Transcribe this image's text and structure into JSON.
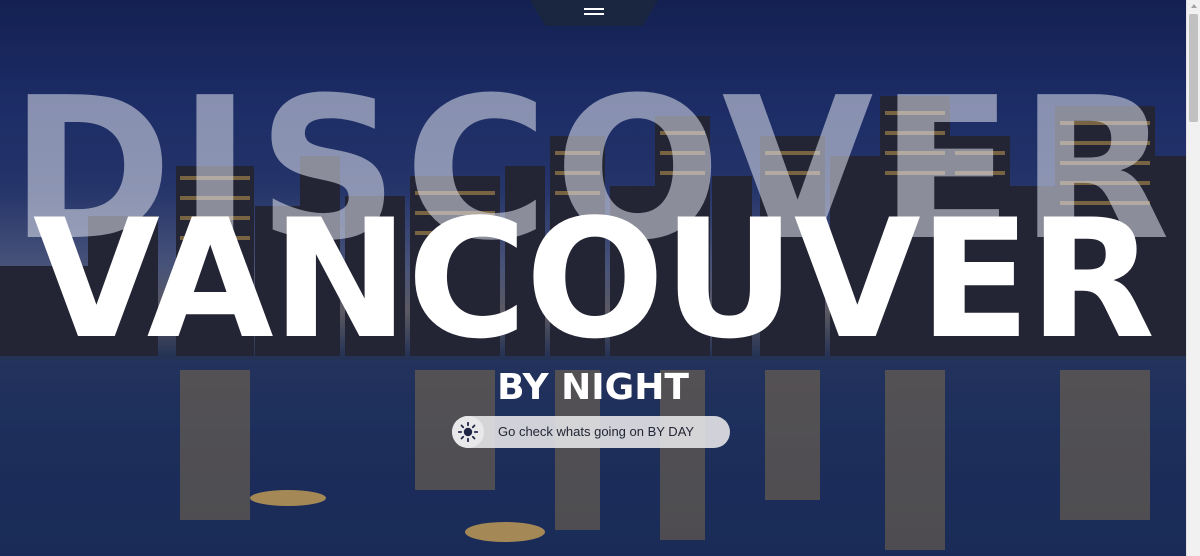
{
  "hero": {
    "headline_top": "DISCOVER",
    "headline_main": "VANCOUVER",
    "subheadline": "BY NIGHT"
  },
  "nav": {
    "menu_icon": "hamburger-menu-icon"
  },
  "day_button": {
    "icon": "sun-icon",
    "label": "Go check whats going on BY DAY"
  },
  "colors": {
    "nav_tab": "#1a2540",
    "button_bg": "#e1e1e4",
    "button_text": "#222533",
    "headline": "#ffffff"
  }
}
